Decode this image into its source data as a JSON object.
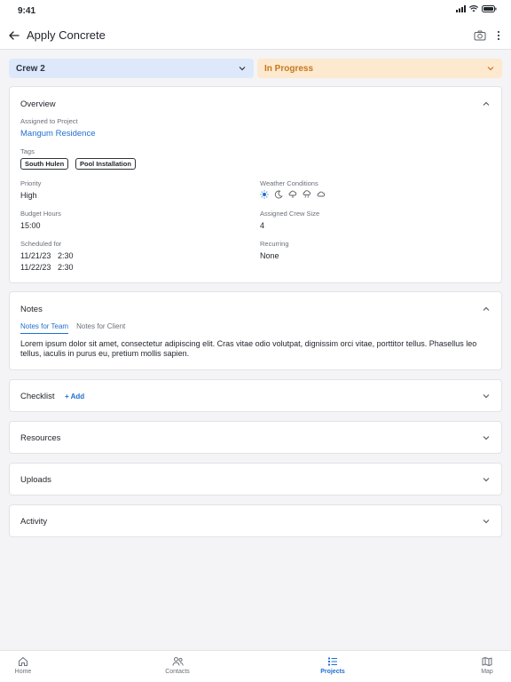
{
  "status_bar": {
    "time": "9:41"
  },
  "header": {
    "title": "Apply Concrete"
  },
  "selectors": {
    "crew": "Crew 2",
    "status": "In Progress"
  },
  "overview": {
    "title": "Overview",
    "assigned_label": "Assigned to Project",
    "project": "Mangum Residence",
    "tags_label": "Tags",
    "tags": [
      "South Hulen",
      "Pool Installation"
    ],
    "priority_label": "Priority",
    "priority": "High",
    "weather_label": "Weather Conditions",
    "weather_icons": [
      "sun-icon",
      "moon-icon",
      "rain-icon",
      "cloud-rain-icon",
      "cloud-icon"
    ],
    "budget_label": "Budget Hours",
    "budget": "15:00",
    "crew_size_label": "Assigned Crew Size",
    "crew_size": "4",
    "scheduled_label": "Scheduled for",
    "scheduled": [
      {
        "date": "11/21/23",
        "time": "2:30"
      },
      {
        "date": "11/22/23",
        "time": "2:30"
      }
    ],
    "recurring_label": "Recurring",
    "recurring": "None"
  },
  "notes": {
    "title": "Notes",
    "tabs": [
      "Notes for Team",
      "Notes for Client"
    ],
    "body": "Lorem ipsum dolor sit amet, consectetur adipiscing elit. Cras vitae odio volutpat, dignissim orci vitae, porttitor tellus. Phasellus leo tellus, iaculis in purus eu, pretium mollis sapien."
  },
  "checklist": {
    "title": "Checklist",
    "add_label": "+ Add"
  },
  "resources": {
    "title": "Resources"
  },
  "uploads": {
    "title": "Uploads"
  },
  "activity": {
    "title": "Activity"
  },
  "tab_bar": {
    "home": "Home",
    "contacts": "Contacts",
    "projects": "Projects",
    "map": "Map"
  },
  "colors": {
    "accent": "#1f6fd1",
    "crew_bg": "#dde9fb",
    "status_bg": "#fde9cf",
    "status_text": "#c6781e"
  }
}
